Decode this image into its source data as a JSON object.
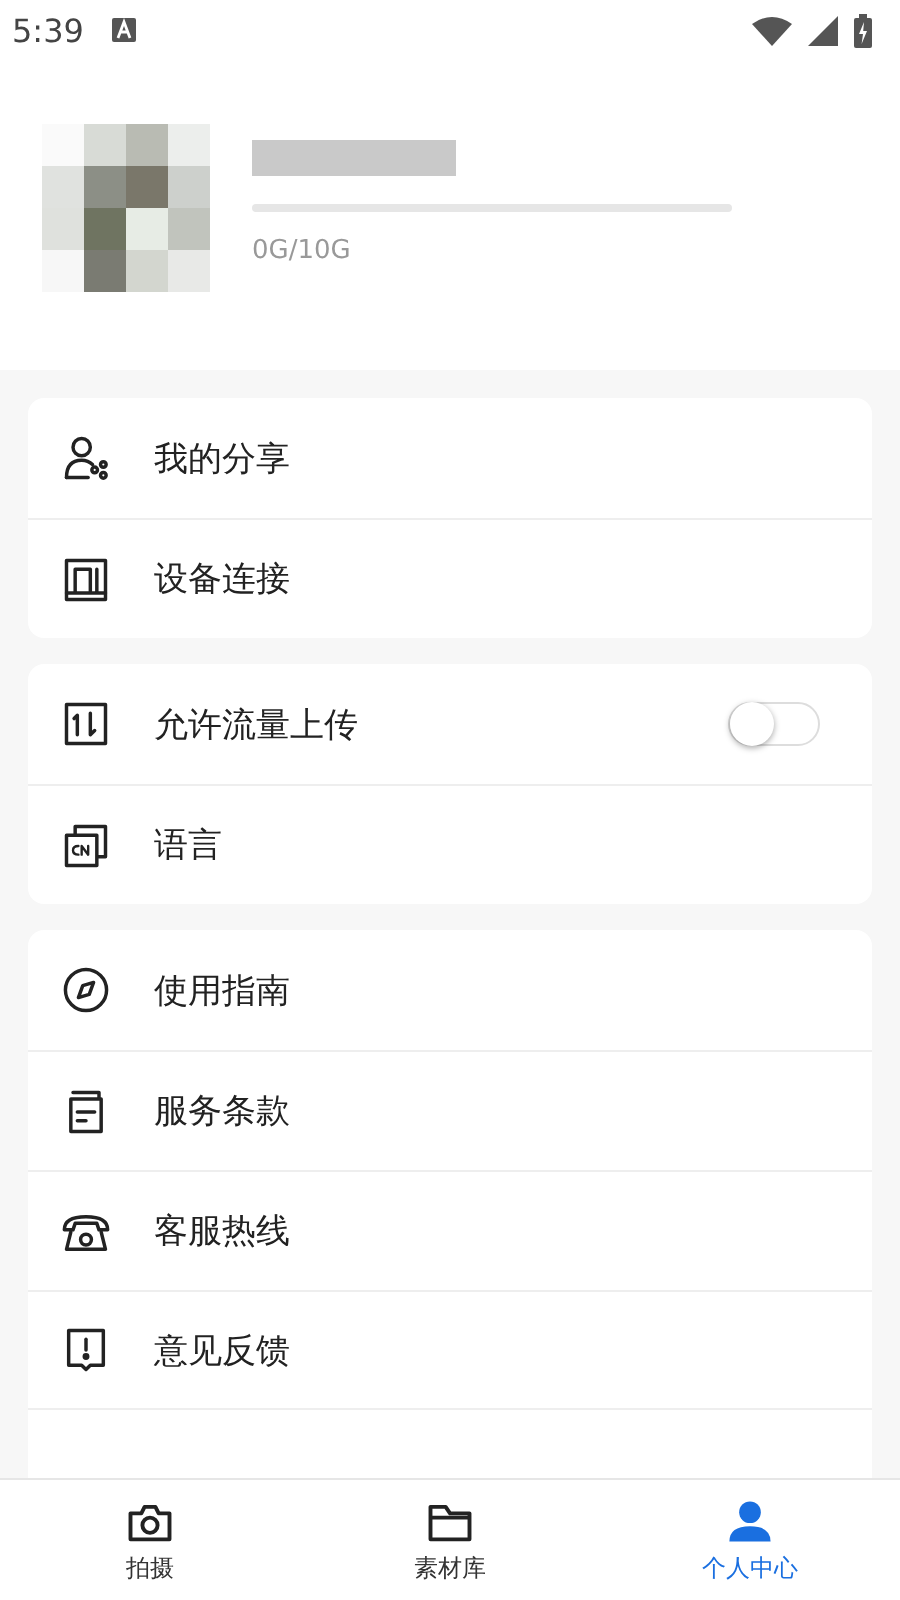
{
  "status_bar": {
    "time": "5:39"
  },
  "profile": {
    "storage": {
      "level": 0,
      "reading": "0G/10G"
    }
  },
  "menu_groups": [
    {
      "items": [
        {
          "kind": "link",
          "label": "我的分享"
        },
        {
          "kind": "link",
          "label": "设备连接"
        }
      ]
    },
    {
      "items": [
        {
          "kind": "toggle",
          "label": "允许流量上传",
          "on": false
        },
        {
          "kind": "link",
          "label": "语言"
        }
      ]
    },
    {
      "items": [
        {
          "kind": "link",
          "label": "使用指南"
        },
        {
          "kind": "link",
          "label": "服务条款"
        },
        {
          "kind": "link",
          "label": "客服热线"
        },
        {
          "kind": "link",
          "label": "意见反馈"
        }
      ]
    }
  ],
  "bottom_nav": [
    {
      "label": "拍摄",
      "selected": false
    },
    {
      "label": "素材库",
      "selected": false
    },
    {
      "label": "个人中心",
      "selected": true
    }
  ]
}
